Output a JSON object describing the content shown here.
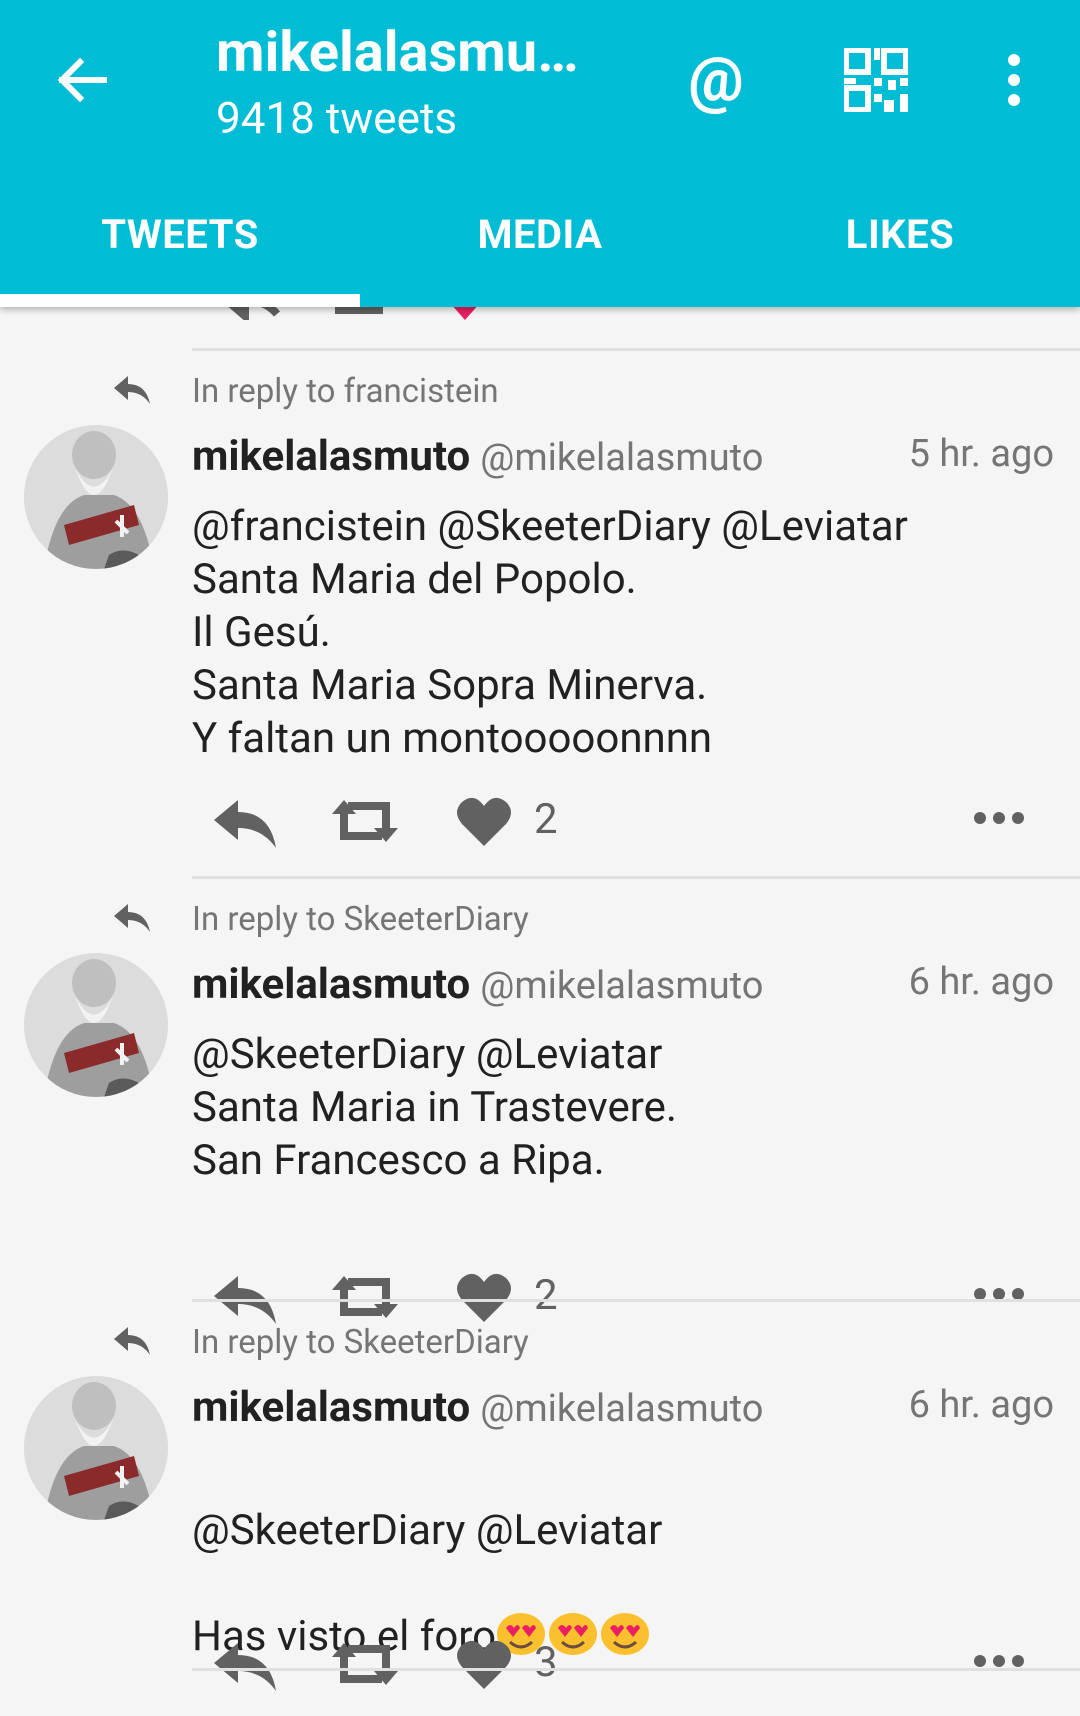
{
  "header": {
    "title": "mikelalasmu…",
    "subtitle": "9418 tweets",
    "at_symbol": "@",
    "accent_color": "#00bcd4",
    "icons": {
      "back": "arrow-back-icon",
      "mention": "at-icon",
      "qr": "qr-code-icon",
      "more": "more-vert-icon"
    }
  },
  "tabs": [
    {
      "label": "TWEETS",
      "active": true
    },
    {
      "label": "MEDIA",
      "active": false
    },
    {
      "label": "LIKES",
      "active": false
    }
  ],
  "tweets": [
    {
      "reply_to": "In reply to francistein",
      "username": "mikelalasmuto",
      "handle": "@mikelalasmuto",
      "time": "5 hr. ago",
      "text": "@francistein @SkeeterDiary @Leviatar\nSanta Maria del Popolo.\nIl Gesú.\nSanta Maria Sopra Minerva.\nY faltan un montooooonnnn",
      "likes": "2"
    },
    {
      "reply_to": "In reply to SkeeterDiary",
      "username": "mikelalasmuto",
      "handle": "@mikelalasmuto",
      "time": "6 hr. ago",
      "text": "@SkeeterDiary @Leviatar\nSanta Maria in Trastevere.\nSan Francesco a Ripa.",
      "likes": "2"
    },
    {
      "reply_to": "In reply to SkeeterDiary",
      "username": "mikelalasmuto",
      "handle": "@mikelalasmuto",
      "time": "6 hr. ago",
      "text_line1": "@SkeeterDiary @Leviatar",
      "text_line2": "Has visto el foro",
      "emojis": [
        "smiling-face-with-heart-eyes",
        "smiling-face-with-heart-eyes",
        "smiling-face-with-heart-eyes"
      ],
      "likes": "3"
    }
  ]
}
